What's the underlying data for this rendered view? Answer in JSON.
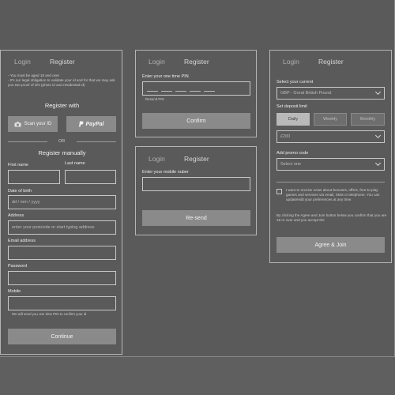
{
  "tabs": {
    "login": "Login",
    "register": "Register"
  },
  "panel1": {
    "notes": [
      "- You must be aged 18 and over",
      "- It's our legal obligation to validate your id and for that we may ask you two proof of id's (photo id and residential id)"
    ],
    "register_with": "Register with",
    "scan_id": "Scan your ID",
    "paypal": "PayPal",
    "or": "OR",
    "register_manually": "Register manually",
    "first_name": "First name",
    "last_name": "Last name",
    "dob_label": "Date of birth",
    "dob_placeholder": "dd  /  mm  /  yyyy",
    "address_label": "Address",
    "address_placeholder": "enter your postcode or start typing address",
    "email_label": "Email address",
    "password_label": "Password",
    "mobile_label": "Mobile",
    "mobile_note": "We will send you one time PIN to confirm your id",
    "continue": "Continue"
  },
  "panel2": {
    "pin_label": "Enter your one time PIN",
    "resend_pin": "Resend PIN",
    "confirm": "Confirm"
  },
  "panel3": {
    "mobile_label": "Enter your mobile nuber",
    "resend": "Re-send"
  },
  "panel4": {
    "currency_label": "Select your current",
    "currency_value": "GBP - Great British Pound",
    "deposit_label": "Set deposit limit",
    "periods": [
      "Daily",
      "Weekly",
      "Monthly"
    ],
    "active_period": "Daily",
    "amount_value": "£200",
    "promo_label": "Add promo code",
    "promo_placeholder": "Select one",
    "news_text": "I want to receive news about bonuses, offers, free-to-play games and services via email, SMS or telephone. You can update/edit your preferences at any time.",
    "agree_text": "By clicking the Agree and Join button below you confirm that you are 18 or over and you accept the",
    "agree_join": "Agree & Join"
  },
  "colors": {
    "background": "#5a5a5a",
    "button": "#8a8a8a",
    "active_segment": "#b9b9b9",
    "border": "#b5b5b5"
  }
}
